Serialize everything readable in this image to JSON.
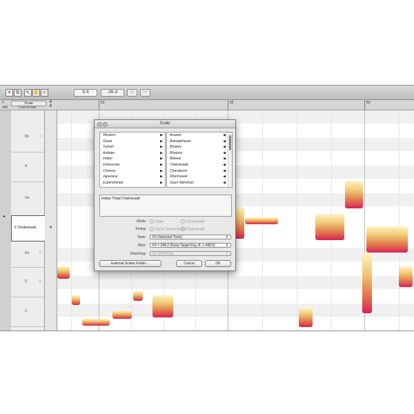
{
  "toolbar": {
    "note_field": "D 4",
    "cents_field": "-26 ct",
    "tools": [
      "main-tool-icon",
      "pitch-tool-icon",
      "pointer-icon",
      "hand-icon",
      "zoom-icon"
    ]
  },
  "header": {
    "col_f": "F",
    "col_hz": "440",
    "scale_label": "Scale",
    "scale_name": "Chakravaak",
    "time_sig_top": "4",
    "time_sig_bottom": "4",
    "bar_numbers": [
      "51",
      "52",
      "53"
    ]
  },
  "notes": [
    "Bb",
    "A",
    "Gb",
    "F Chakravaak",
    "Eb",
    "D",
    "C"
  ],
  "selected_note_number": "4",
  "dialog": {
    "title": "Scale",
    "categories": [
      "Western",
      "Greek",
      "Turkish",
      "Arabian",
      "Indian",
      "Indonesian",
      "Chinese",
      "Japanese",
      "Experimental"
    ],
    "scales": [
      "Asavari",
      "Bakulabharan",
      "Bhairav",
      "Bhairavi",
      "Bilawal",
      "Chakravaak",
      "Charukeshi",
      "Dharmavati",
      "Gauri Manohari"
    ],
    "description": "Indian Thaat Chakravaak",
    "mode_label": "Mode:",
    "mode_options": [
      "Major",
      "Chakravaak"
    ],
    "tuning_label": "Tuning:",
    "tuning_options": [
      "Equal Temperament",
      "Chakravaak"
    ],
    "tonic_label": "Tonic:",
    "tonic_value": "F4   (Selected Tonic)",
    "pitch_label": "Pitch:",
    "pitch_value": "F4 = 349.2  (Keep Target Key, A -> 440.0)",
    "stretching_label": "Stretching:",
    "stretching_value": "No Stretching",
    "external_button": "External Scales Folder ...",
    "cancel_button": "Cancel",
    "ok_button": "OK"
  }
}
